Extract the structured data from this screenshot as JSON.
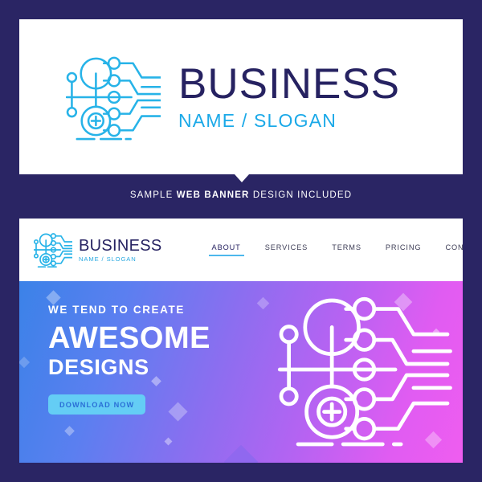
{
  "theme": {
    "page_background": "#2a2564",
    "card_background": "#ffffff",
    "brand_navy": "#262261",
    "brand_cyan": "#1ba9e8",
    "accent_button": "#64cdf5",
    "button_text": "#2a6fd6",
    "nav_underline": "#4db8ec",
    "gradient_start": "#3b82e8",
    "gradient_end": "#ef5df0"
  },
  "logo_card": {
    "icon": "network-nodes-icon",
    "title": "BUSINESS",
    "slogan": "NAME / SLOGAN"
  },
  "sample_strip": {
    "prefix": "SAMPLE ",
    "emphasis": "WEB BANNER",
    "suffix": " DESIGN INCLUDED"
  },
  "banner_card": {
    "nav": {
      "icon": "network-nodes-icon",
      "brand_title": "BUSINESS",
      "brand_slogan": "NAME / SLOGAN",
      "links": [
        {
          "label": "ABOUT",
          "active": true
        },
        {
          "label": "SERVICES",
          "active": false
        },
        {
          "label": "TERMS",
          "active": false
        },
        {
          "label": "PRICING",
          "active": false
        },
        {
          "label": "CONTACT",
          "active": false
        }
      ]
    },
    "hero": {
      "kicker": "WE TEND TO CREATE",
      "headline": "AWESOME",
      "subhead": "DESIGNS",
      "cta_label": "DOWNLOAD NOW",
      "art_icon": "network-nodes-icon"
    }
  }
}
